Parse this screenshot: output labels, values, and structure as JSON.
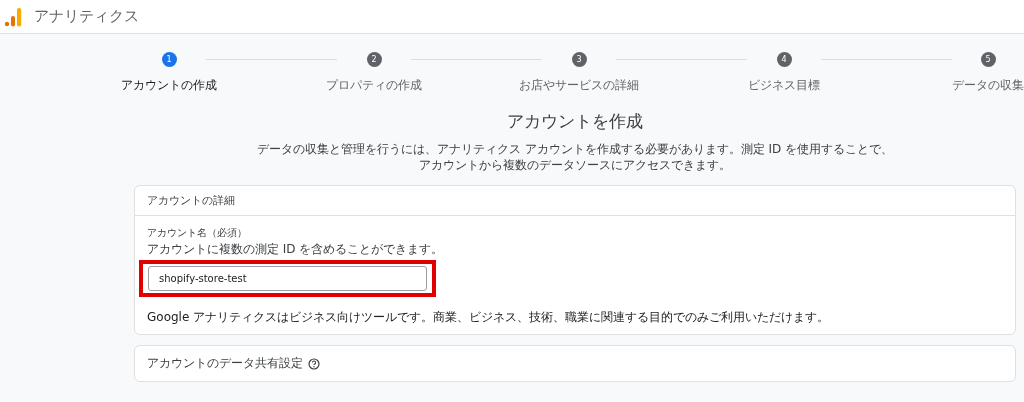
{
  "header": {
    "app_name": "アナリティクス"
  },
  "steps": [
    {
      "number": "1",
      "label": "アカウントの作成",
      "selected": true
    },
    {
      "number": "2",
      "label": "プロパティの作成",
      "selected": false
    },
    {
      "number": "3",
      "label": "お店やサービスの詳細",
      "selected": false
    },
    {
      "number": "4",
      "label": "ビジネス目標",
      "selected": false
    },
    {
      "number": "5",
      "label": "データの収集",
      "selected": false
    }
  ],
  "page_title": "アカウントを作成",
  "description": "データの収集と管理を行うには、アナリティクス アカウントを作成する必要があります。測定 ID を使用することで、アカウントから複数のデータソースにアクセスできます。",
  "account_details": {
    "title": "アカウントの詳細",
    "field_label": "アカウント名（必須）",
    "field_hint": "アカウントに複数の測定 ID を含めることができます。",
    "field_value": "shopify-store-test",
    "highlighted": true,
    "notice": "Google アナリティクスはビジネス向けツールです。商業、ビジネス、技術、職業に関連する目的でのみご利用いただけます。"
  },
  "data_sharing": {
    "title": "アカウントのデータ共有設定"
  }
}
